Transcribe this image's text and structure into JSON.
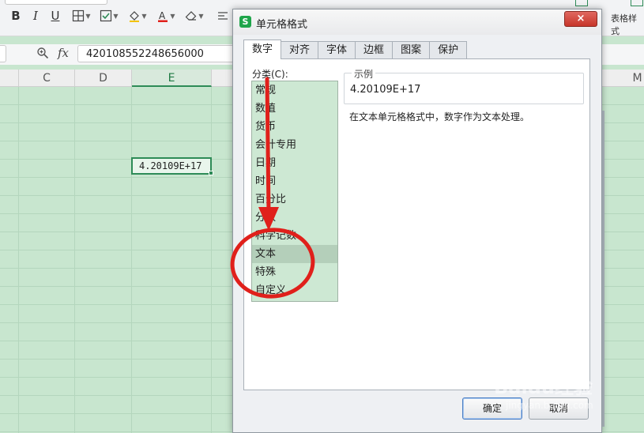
{
  "toolbar": {
    "bold": "B",
    "italic": "I",
    "underline": "U",
    "right_label": "表格样式"
  },
  "formula_bar": {
    "fx_label": "fx",
    "value": "420108552248656000"
  },
  "columns": {
    "c": "C",
    "d": "D",
    "e": "E",
    "m": "M"
  },
  "active_cell": {
    "value": "4.20109E+17"
  },
  "dialog": {
    "title": "单元格格式",
    "logo": "S",
    "close": "×",
    "tabs": [
      "数字",
      "对齐",
      "字体",
      "边框",
      "图案",
      "保护"
    ],
    "active_tab": "数字",
    "category_label": "分类(C):",
    "categories": [
      "常规",
      "数值",
      "货币",
      "会计专用",
      "日期",
      "时间",
      "百分比",
      "分数",
      "科学记数",
      "文本",
      "特殊",
      "自定义"
    ],
    "selected_category": "文本",
    "sample_legend": "示例",
    "sample_value": "4.20109E+17",
    "description": "在文本单元格格式中，数字作为文本处理。",
    "ok_label": "确定",
    "cancel_label": "取消"
  },
  "watermark": {
    "text": "Baidu经验",
    "sub": "jingyan.baidu.com"
  },
  "colors": {
    "sheet_bg": "#c8e6cf",
    "accent_green": "#2e8b57",
    "annotation_red": "#e0201b",
    "list_bg": "#cde8d3",
    "list_selected": "#b4cfba"
  }
}
